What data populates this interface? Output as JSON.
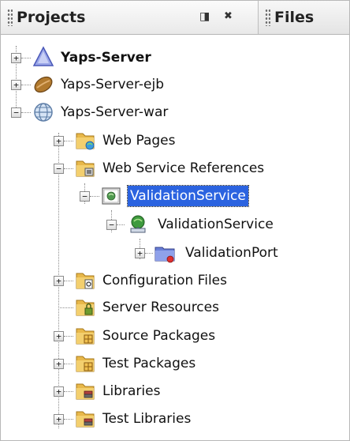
{
  "tabs": [
    {
      "label": "Projects",
      "active": true
    },
    {
      "label": "Files",
      "active": false
    }
  ],
  "tab_controls": {
    "minimize_icon": "minimize-window-icon",
    "close_icon": "close-window-icon",
    "minimize_glyph": "◨",
    "close_glyph": "✖"
  },
  "tree": {
    "yaps_server": {
      "label": "Yaps-Server",
      "expanded": false,
      "icon": "maven-pom-project-icon"
    },
    "yaps_server_ejb": {
      "label": "Yaps-Server-ejb",
      "expanded": false,
      "icon": "ejb-module-icon"
    },
    "yaps_server_war": {
      "label": "Yaps-Server-war",
      "expanded": true,
      "icon": "web-project-globe-icon"
    },
    "web_pages": {
      "label": "Web Pages",
      "expanded": false,
      "icon": "web-pages-folder-icon"
    },
    "web_service_references": {
      "label": "Web Service References",
      "expanded": true,
      "icon": "web-service-references-folder-icon"
    },
    "validation_service_ref": {
      "label": "ValidationService",
      "expanded": true,
      "selected": true,
      "icon": "web-service-reference-icon"
    },
    "validation_service": {
      "label": "ValidationService",
      "expanded": true,
      "icon": "web-service-icon"
    },
    "validation_port": {
      "label": "ValidationPort",
      "expanded": false,
      "icon": "port-icon"
    },
    "configuration_files": {
      "label": "Configuration Files",
      "expanded": false,
      "icon": "configuration-files-folder-icon"
    },
    "server_resources": {
      "label": "Server Resources",
      "expanded": false,
      "icon": "server-resources-folder-icon"
    },
    "source_packages": {
      "label": "Source Packages",
      "expanded": false,
      "icon": "source-packages-folder-icon"
    },
    "test_packages": {
      "label": "Test Packages",
      "expanded": false,
      "icon": "test-packages-folder-icon"
    },
    "libraries": {
      "label": "Libraries",
      "expanded": false,
      "icon": "libraries-folder-icon"
    },
    "test_libraries": {
      "label": "Test Libraries",
      "expanded": false,
      "icon": "test-libraries-folder-icon"
    }
  },
  "colors": {
    "selection": "#2b63e0",
    "folder": "#e8b84a",
    "text": "#111111"
  }
}
